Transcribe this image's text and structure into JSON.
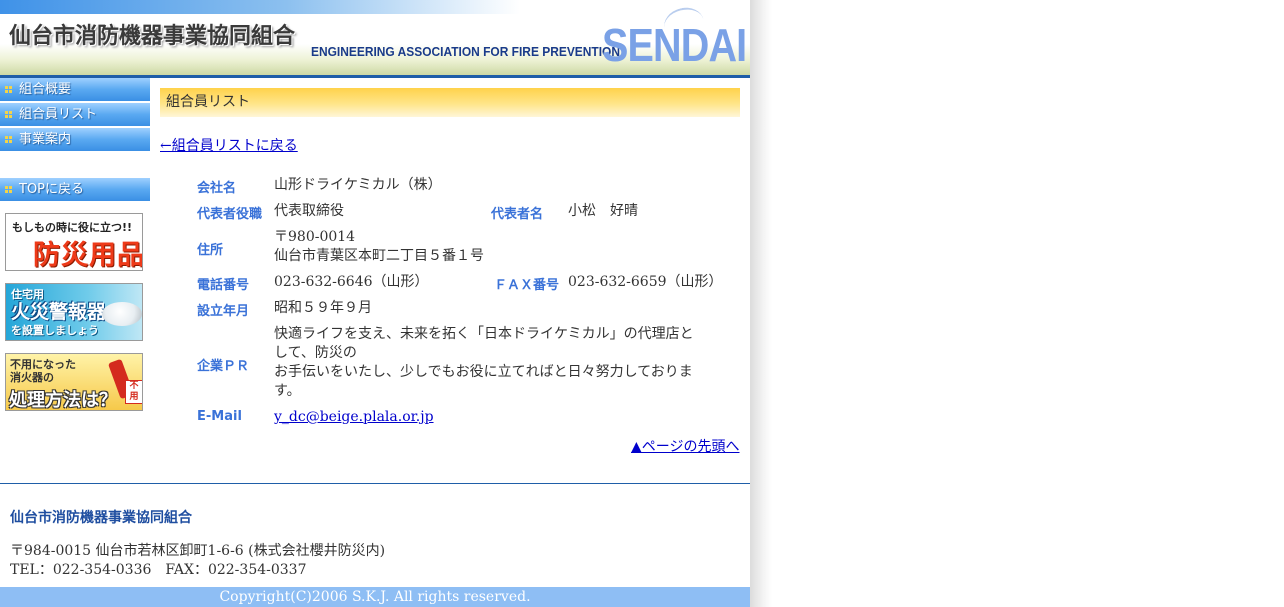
{
  "header": {
    "title": "仙台市消防機器事業協同組合",
    "subtitle": "ENGINEERING ASSOCIATION FOR FIRE PREVENTION",
    "logo_text": "SENDAI"
  },
  "sidebar": {
    "items": [
      {
        "label": "組合概要"
      },
      {
        "label": "組合員リスト"
      },
      {
        "label": "事業案内"
      }
    ],
    "top_link": "TOPに戻る",
    "banners": [
      {
        "line1": "もしもの時に役に立つ!!",
        "line2": "防災用品"
      },
      {
        "line1": "住宅用",
        "line2": "火災警報器",
        "line3": "を設置しましょう"
      },
      {
        "line1": "不用になった",
        "line2": "消火器の",
        "line3": "処理方法は？",
        "tag": "不用"
      }
    ]
  },
  "main": {
    "section_title": "組合員リスト",
    "back_link": "←組合員リストに戻る",
    "company": {
      "name_label": "会社名",
      "name": "山形ドライケミカル（株）",
      "role_label": "代表者役職",
      "role": "代表取締役",
      "rep_label": "代表者名",
      "rep": "小松　好晴",
      "address_label": "住所",
      "zip": "〒980-0014",
      "address": "仙台市青葉区本町二丁目５番１号",
      "tel_label": "電話番号",
      "tel": "023-632-6646（山形）",
      "fax_label": "ＦＡＸ番号",
      "fax": "023-632-6659（山形）",
      "founded_label": "設立年月",
      "founded": "昭和５９年９月",
      "pr_label": "企業ＰＲ",
      "pr_line1": "快適ライフを支え、未来を拓く「日本ドライケミカル」の代理店と",
      "pr_line2": "して、防災の",
      "pr_line3": "お手伝いをいたし、少しでもお役に立てればと日々努力しておりま",
      "pr_line4": "す。",
      "email_label": "E-Mail",
      "email": "y_dc@beige.plala.or.jp"
    },
    "page_top": "▲ページの先頭へ"
  },
  "footer": {
    "org": "仙台市消防機器事業協同組合",
    "address": "〒984-0015 仙台市若林区卸町1-6-6 (株式会社櫻井防災内)",
    "tel_fax": "TEL：022-354-0336　FAX：022-354-0337",
    "copyright": "Copyright(C)2006 S.K.J. All rights reserved."
  },
  "colors": {
    "nav_blue": "#4ea0ee",
    "label_blue": "#3a72d8",
    "section_yellow": "#ffd24b",
    "footer_bar": "#8ebef4",
    "rule_navy": "#1f5ea8"
  }
}
